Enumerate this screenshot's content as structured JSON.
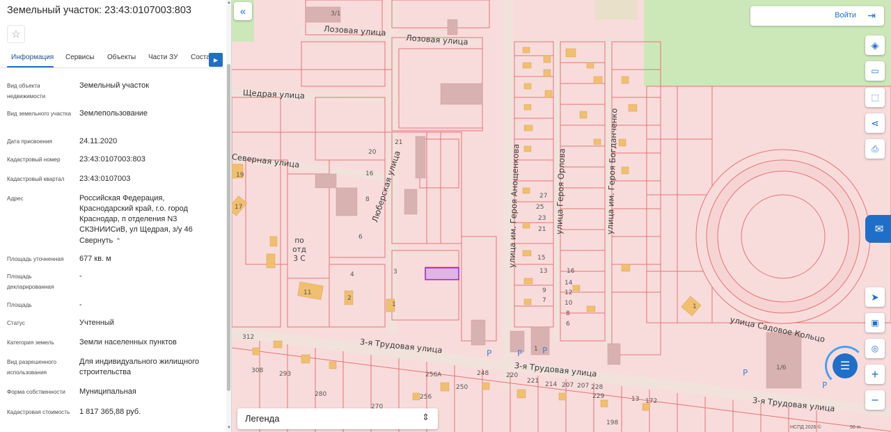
{
  "panel": {
    "title": "Земельный участок: 23:43:0107003:803",
    "tabs": [
      "Информация",
      "Сервисы",
      "Объекты",
      "Части ЗУ",
      "Состав"
    ],
    "rows": [
      {
        "label": "Вид объекта недвижимости",
        "value": "Земельный участок"
      },
      {
        "label": "Вид земельного участка",
        "value": "Землепользование"
      },
      {
        "label": "Дата присвоения",
        "value": "24.11.2020"
      },
      {
        "label": "Кадастровый номер",
        "value": "23:43:0107003:803"
      },
      {
        "label": "Кадастровый квартал",
        "value": "23:43:0107003"
      },
      {
        "label": "Адрес",
        "value": "Российская Федерация, Краснодарский край, г.о. город Краснодар, п отделения N3 СКЗНИИСиВ, ул Щедрая, з/у 46"
      },
      {
        "label": "Площадь уточненная",
        "value": "677 кв. м"
      },
      {
        "label": "Площадь декларированная",
        "value": "-"
      },
      {
        "label": "Площадь",
        "value": "-"
      },
      {
        "label": "Статус",
        "value": "Учтенный"
      },
      {
        "label": "Категория земель",
        "value": "Земли населенных пунктов"
      },
      {
        "label": "Вид разрешенного использования",
        "value": "Для индивидуального жилищного строительства"
      },
      {
        "label": "Форма собственности",
        "value": "Муниципальная"
      },
      {
        "label": "Кадастровая стоимость",
        "value": "1 817 365,88 руб."
      }
    ],
    "collapse_label": "Свернуть"
  },
  "map": {
    "login_label": "Войти",
    "legend_label": "Легенда",
    "attribution": "НСПД 2026 ©",
    "scale_label": "50 m",
    "streets": [
      "Лозовая улица",
      "Лозовая улица",
      "Щедрая улица",
      "Северная улица",
      "Люберская улица",
      "улица им. Героя Анощенкова",
      "улица Героя Орлова",
      "улица им. Героя Богданченко",
      "3-я Трудовая улица",
      "3-я Трудовая улица",
      "3-я Трудовая улица",
      "улица Садовое Кольцо",
      "по отд 3 С"
    ]
  },
  "colors": {
    "accent": "#1f6fc9",
    "map_bg": "#f8dcdc",
    "parcel_line": "#e57373",
    "building": "#f0c070",
    "green": "#cde8b8",
    "selected": "#a020c8"
  },
  "icons": [
    "collapse-panel-icon",
    "star-icon",
    "login-icon",
    "layers-icon",
    "ruler-icon",
    "select-area-icon",
    "share-icon",
    "print-icon",
    "feedback-icon",
    "locate-icon",
    "screen-icon",
    "pin-icon",
    "zoom-in-icon",
    "zoom-out-icon",
    "chat-icon",
    "legend-toggle-icon"
  ]
}
